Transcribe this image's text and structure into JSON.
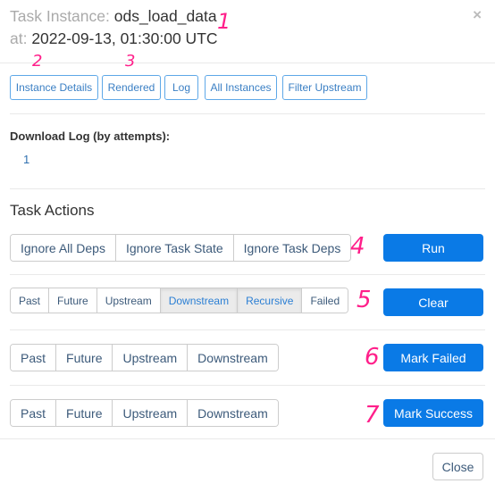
{
  "modal": {
    "title_label": "Task Instance: ",
    "task_id": "ods_load_data",
    "date_label": "at: ",
    "execution_date": "2022-09-13, 01:30:00 UTC",
    "close_icon": "×"
  },
  "nav_buttons": [
    {
      "label": "Instance Details"
    },
    {
      "label": "Rendered"
    },
    {
      "label": "Log"
    },
    {
      "label": "All Instances"
    },
    {
      "label": "Filter Upstream"
    }
  ],
  "download_log": {
    "title": "Download Log (by attempts):",
    "attempts": [
      "1"
    ]
  },
  "task_actions": {
    "title": "Task Actions",
    "run": {
      "options": [
        {
          "label": "Ignore All Deps",
          "active": false
        },
        {
          "label": "Ignore Task State",
          "active": false
        },
        {
          "label": "Ignore Task Deps",
          "active": false
        }
      ],
      "button": "Run"
    },
    "clear": {
      "options": [
        {
          "label": "Past",
          "active": false
        },
        {
          "label": "Future",
          "active": false
        },
        {
          "label": "Upstream",
          "active": false
        },
        {
          "label": "Downstream",
          "active": true
        },
        {
          "label": "Recursive",
          "active": true
        },
        {
          "label": "Failed",
          "active": false
        }
      ],
      "button": "Clear"
    },
    "mark_failed": {
      "options": [
        {
          "label": "Past",
          "active": false
        },
        {
          "label": "Future",
          "active": false
        },
        {
          "label": "Upstream",
          "active": false
        },
        {
          "label": "Downstream",
          "active": false
        }
      ],
      "button": "Mark Failed"
    },
    "mark_success": {
      "options": [
        {
          "label": "Past",
          "active": false
        },
        {
          "label": "Future",
          "active": false
        },
        {
          "label": "Upstream",
          "active": false
        },
        {
          "label": "Downstream",
          "active": false
        }
      ],
      "button": "Mark Success"
    }
  },
  "footer": {
    "close_label": "Close"
  },
  "annotations": [
    "1",
    "2",
    "3",
    "4",
    "5",
    "6",
    "7"
  ],
  "colors": {
    "primary": "#0a7ae6",
    "link": "#3070b0",
    "annotation": "#ff1f8a"
  }
}
